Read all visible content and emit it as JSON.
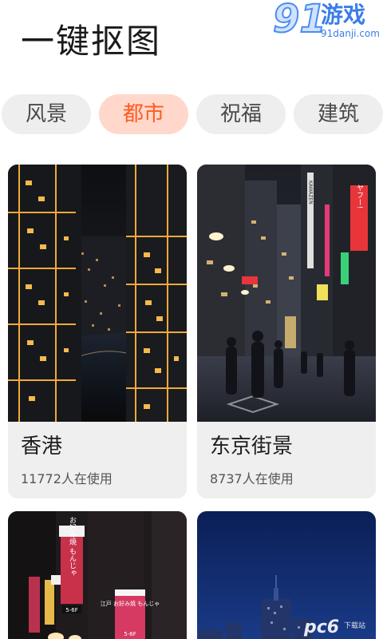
{
  "header": {
    "title": "一键抠图"
  },
  "watermark": {
    "number": "91",
    "name": "游戏",
    "domain": "91danji.com"
  },
  "tabs": [
    {
      "label": "风景",
      "active": false
    },
    {
      "label": "都市",
      "active": true
    },
    {
      "label": "祝福",
      "active": false
    },
    {
      "label": "建筑",
      "active": false
    }
  ],
  "cards": [
    {
      "name": "香港",
      "usage": "11772人在使用"
    },
    {
      "name": "东京街景",
      "usage": "8737人在使用"
    }
  ],
  "photo_signs": {
    "sign_red_text": "ヤフー!",
    "sign_kawazen": "KAWAZEN",
    "sign_okonomi": "お好み焼 もんじゃ",
    "sign_floor": "5-6F",
    "sign_edo": "江戸 お好み焼 もんじゃ",
    "sign_floor_b": "5-6F"
  },
  "bottom_watermark": {
    "brand": "pc6",
    "sub": "下载站"
  },
  "colors": {
    "accent": "#ff5a22",
    "accent_bg": "#ffd8cb",
    "tab_bg": "#eeeeee",
    "card_bg": "#efefef"
  }
}
